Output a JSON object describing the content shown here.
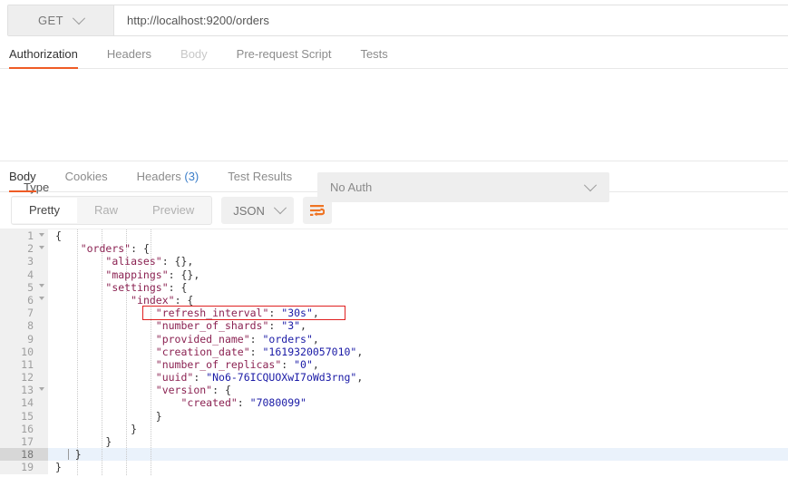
{
  "request": {
    "method": "GET",
    "url": "http://localhost:9200/orders",
    "method_caret_icon": "chevron-down-icon",
    "tabs": [
      {
        "label": "Authorization",
        "state": "active"
      },
      {
        "label": "Headers",
        "state": "normal"
      },
      {
        "label": "Body",
        "state": "disabled"
      },
      {
        "label": "Pre-request Script",
        "state": "normal"
      },
      {
        "label": "Tests",
        "state": "normal"
      }
    ]
  },
  "auth": {
    "type_label": "Type",
    "selected": "No Auth",
    "caret_icon": "chevron-down-icon"
  },
  "response": {
    "tabs": [
      {
        "label": "Body",
        "count": "",
        "state": "active"
      },
      {
        "label": "Cookies",
        "count": "",
        "state": "normal"
      },
      {
        "label": "Headers",
        "count": "(3)",
        "state": "normal"
      },
      {
        "label": "Test Results",
        "count": "",
        "state": "normal"
      }
    ],
    "view_modes": [
      {
        "label": "Pretty",
        "state": "active"
      },
      {
        "label": "Raw",
        "state": "normal"
      },
      {
        "label": "Preview",
        "state": "normal"
      }
    ],
    "format": "JSON",
    "format_caret_icon": "chevron-down-icon",
    "wrap_icon": "word-wrap-icon"
  },
  "code": {
    "language": "json",
    "highlighted_line": 7,
    "active_line": 18,
    "lines": [
      {
        "n": "1",
        "fold": true,
        "indent": 0,
        "text": "{"
      },
      {
        "n": "2",
        "fold": true,
        "indent": 1,
        "text": "\"orders\": {"
      },
      {
        "n": "3",
        "fold": false,
        "indent": 2,
        "text": "\"aliases\": {},"
      },
      {
        "n": "4",
        "fold": false,
        "indent": 2,
        "text": "\"mappings\": {},"
      },
      {
        "n": "5",
        "fold": true,
        "indent": 2,
        "text": "\"settings\": {"
      },
      {
        "n": "6",
        "fold": true,
        "indent": 3,
        "text": "\"index\": {"
      },
      {
        "n": "7",
        "fold": false,
        "indent": 4,
        "text": "\"refresh_interval\": \"30s\","
      },
      {
        "n": "8",
        "fold": false,
        "indent": 4,
        "text": "\"number_of_shards\": \"3\","
      },
      {
        "n": "9",
        "fold": false,
        "indent": 4,
        "text": "\"provided_name\": \"orders\","
      },
      {
        "n": "10",
        "fold": false,
        "indent": 4,
        "text": "\"creation_date\": \"1619320057010\","
      },
      {
        "n": "11",
        "fold": false,
        "indent": 4,
        "text": "\"number_of_replicas\": \"0\","
      },
      {
        "n": "12",
        "fold": false,
        "indent": 4,
        "text": "\"uuid\": \"No6-76ICQUOXwI7oWd3rng\","
      },
      {
        "n": "13",
        "fold": true,
        "indent": 4,
        "text": "\"version\": {"
      },
      {
        "n": "14",
        "fold": false,
        "indent": 5,
        "text": "\"created\": \"7080099\""
      },
      {
        "n": "15",
        "fold": false,
        "indent": 4,
        "text": "}"
      },
      {
        "n": "16",
        "fold": false,
        "indent": 3,
        "text": "}"
      },
      {
        "n": "17",
        "fold": false,
        "indent": 2,
        "text": "}"
      },
      {
        "n": "18",
        "fold": false,
        "indent": 1,
        "text": "}"
      },
      {
        "n": "19",
        "fold": false,
        "indent": 0,
        "text": "}"
      }
    ]
  },
  "colors": {
    "accent": "#ef5b25",
    "key": "#8b2252",
    "string": "#1a1aa6",
    "link": "#3a7dc9",
    "annotation": "#e02020"
  }
}
